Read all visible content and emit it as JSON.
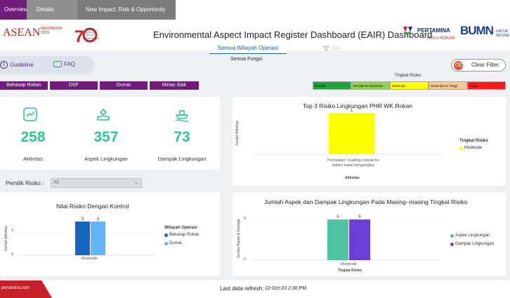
{
  "tabs": [
    {
      "label": "Overview"
    },
    {
      "label": "Details"
    },
    {
      "label": "New Impact, Risk & Opportunity"
    }
  ],
  "header": {
    "asean_label": "ASEAN",
    "asean_sub": "INDONESIA 2023",
    "ri_tagline": "TERUS MELAJU UNTUK INDONESIA MAJU",
    "title": "Environmental Aspect Impact Register Dashboard (EAIR) Dashboard",
    "pertamina_name": "PERTAMINA",
    "pertamina_sub": "HULU ROKAN",
    "bumn_label": "BUMN",
    "bumn_sub": "UNTUK INDONESIA"
  },
  "filters": {
    "wilayah_label": "Semua Wilayah Operasi",
    "fungsi_label": "Semua Fungsi",
    "clear_filter_label": "Clear Filter",
    "guideline_label": "Guideline",
    "faq_label": "FAQ"
  },
  "regions": [
    "Bekasap Rokan",
    "DSF",
    "Dumai",
    "Minas Siak"
  ],
  "risk_level": {
    "title": "Tingkat Risiko",
    "levels": [
      {
        "label": "Rendah",
        "color": "#1fa33a"
      },
      {
        "label": "Rendah ke Moderate",
        "color": "#92d050"
      },
      {
        "label": "Moderate",
        "color": "#ffff00"
      },
      {
        "label": "Moderate ke Tinggi",
        "color": "#f8c98e"
      },
      {
        "label": "Tinggi",
        "color": "#ff1a1a"
      }
    ]
  },
  "kpis": [
    {
      "value": "258",
      "label": "Aktivitas",
      "icon": "chart-line-icon"
    },
    {
      "value": "357",
      "label": "Aspek Lingkungan",
      "icon": "plant-hand-icon"
    },
    {
      "value": "73",
      "label": "Dampak Lingkungan",
      "icon": "ship-icon"
    }
  ],
  "pemilik": {
    "label": "Pemilik Risiko :",
    "selected": "All"
  },
  "chart_data": [
    {
      "type": "bar",
      "title": "Top 3 Risiko Lingkungan PHR WK Rokan",
      "ylabel": "Jumlah Aktivitas",
      "xlabel": "Aktivitas",
      "categories": [
        "Pemuatan / loading minyak ke dalam kapal pengangkut"
      ],
      "series": [
        {
          "values": [
            1
          ],
          "color": "#ffff00"
        }
      ],
      "legend": {
        "title": "Tingkat Risiko",
        "items": [
          {
            "label": "Moderate",
            "color": "#ffff00"
          }
        ],
        "position": "right"
      }
    },
    {
      "type": "bar",
      "title": "Nilai Risiko Dengan Kontrol",
      "ylabel": "Jumlah Aktivitas",
      "categories": [
        "Moderate"
      ],
      "yticks": [
        "0",
        "2"
      ],
      "series": [
        {
          "name": "Bekasap Rokan",
          "values": [
            3
          ],
          "color": "#1565c0"
        },
        {
          "name": "Dumai",
          "values": [
            3
          ],
          "color": "#64b5f6"
        }
      ],
      "legend": {
        "title": "Wilayah Operasi",
        "position": "right"
      }
    },
    {
      "type": "bar",
      "title": "Jumlah Aspek dan Dampak Lingkungan Pada Masing–masing Tingkat Risiko",
      "ylabel": "Jumlah Aspek & Dampak",
      "xlabel": "Tingkat Risiko",
      "categories": [
        "Moderate"
      ],
      "yticks": [
        "0",
        "5"
      ],
      "series": [
        {
          "name": "Aspek Lingkungan",
          "values": [
            5
          ],
          "color": "#4fc3a1"
        },
        {
          "name": "Dampak Lingkungan",
          "values": [
            5
          ],
          "color": "#6a3fd8"
        }
      ],
      "legend": {
        "position": "right"
      }
    }
  ],
  "footer": {
    "url": "pertamina.com",
    "refresh_label": "Last data refresh:",
    "refresh_value": "12-Oct-23 2:38 PM"
  }
}
